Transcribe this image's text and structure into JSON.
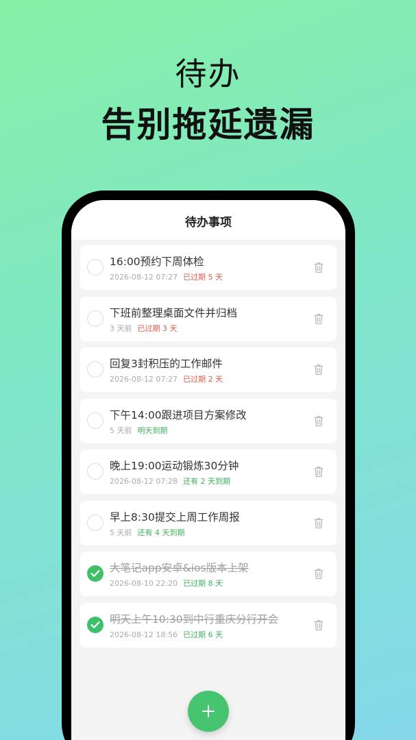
{
  "hero": {
    "line1": "待办",
    "line2": "告别拖延遗漏"
  },
  "appbar": {
    "title": "待办事项"
  },
  "colors": {
    "accent": "#46c46f",
    "overdue": "#e05a4a",
    "ok": "#3fb25f"
  },
  "todos": [
    {
      "title": "16:00预约下周体检",
      "time": "2026-08-12 07:27",
      "status": "已过期 5 天",
      "status_tone": "red",
      "done": false
    },
    {
      "title": "下班前整理桌面文件并归档",
      "time": "3 天前",
      "status": "已过期 3 天",
      "status_tone": "red",
      "done": false
    },
    {
      "title": "回复3封积压的工作邮件",
      "time": "2026-08-12 07:27",
      "status": "已过期 2 天",
      "status_tone": "red",
      "done": false
    },
    {
      "title": "下午14:00跟进项目方案修改",
      "time": "5 天前",
      "status": "明天到期",
      "status_tone": "green",
      "done": false
    },
    {
      "title": "晚上19:00运动锻炼30分钟",
      "time": "2026-08-12 07:28",
      "status": "还有 2 天到期",
      "status_tone": "green",
      "done": false
    },
    {
      "title": "早上8:30提交上周工作周报",
      "time": "5 天前",
      "status": "还有 4 天到期",
      "status_tone": "green",
      "done": false
    },
    {
      "title": "大笔记app安卓&ios版本上架",
      "time": "2026-08-10 22:20",
      "status": "已过期 8 天",
      "status_tone": "green",
      "done": true
    },
    {
      "title": "明天上午10:30到中行重庆分行开会",
      "time": "2026-08-12 18:56",
      "status": "已过期 6 天",
      "status_tone": "green",
      "done": true
    }
  ],
  "icons": {
    "delete": "trash-icon",
    "add": "plus-icon",
    "check": "checkmark-icon"
  }
}
